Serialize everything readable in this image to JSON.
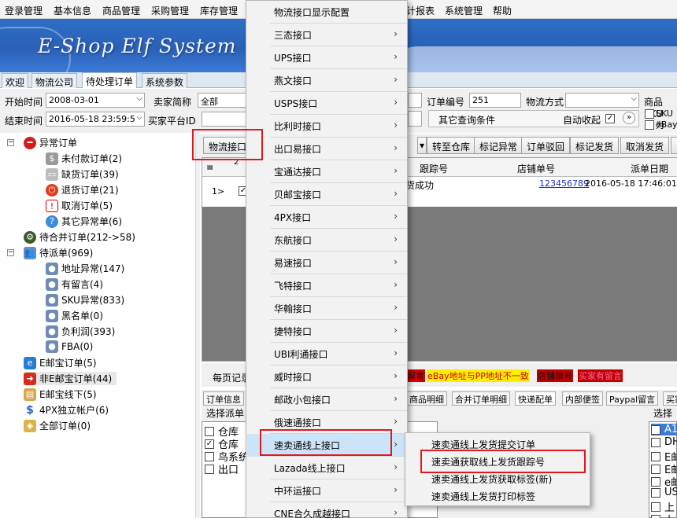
{
  "menubar": [
    "登录管理",
    "基本信息",
    "商品管理",
    "采购管理",
    "库存管理",
    "计报表",
    "系统管理",
    "帮助"
  ],
  "banner": {
    "title": "E-Shop Elf System"
  },
  "main_tabs": [
    "欢迎",
    "物流公司",
    "待处理订单",
    "系统参数"
  ],
  "filters": {
    "start_time_label": "开始时间",
    "start_time": "2008-03-01",
    "end_time_label": "结束时间",
    "end_time": "2016-05-18 23:59:5",
    "buyer_short_label": "卖家简称",
    "buyer_short_value": "全部",
    "buyer_platform_label": "买家平台ID",
    "order_no_label": "订单编号",
    "order_no_value": "251",
    "logistics_label": "物流方式",
    "other_query": "其它查询条件",
    "auto_collapse": "自动收起",
    "sku_label": "商品SKU",
    "sku_cb1": "SKU为",
    "sku_cb2": "eBay"
  },
  "tree": {
    "items": [
      {
        "label": "异常订单",
        "icon": "no-entry-icon"
      },
      {
        "label": "未付款订单(2)",
        "icon": "dollar-icon"
      },
      {
        "label": "缺货订单(39)",
        "icon": "box-icon"
      },
      {
        "label": "退货订单(21)",
        "icon": "power-icon"
      },
      {
        "label": "取消订单(5)",
        "icon": "warning-icon"
      },
      {
        "label": "其它异常单(6)",
        "icon": "question-icon"
      },
      {
        "label": "待合并订单(212->58)",
        "icon": "gear-icon"
      },
      {
        "label": "待派单(969)",
        "icon": "users-icon"
      },
      {
        "label": "地址异常(147)",
        "icon": "user-icon"
      },
      {
        "label": "有留言(4)",
        "icon": "user-icon"
      },
      {
        "label": "SKU异常(833)",
        "icon": "user-icon"
      },
      {
        "label": "黑名单(0)",
        "icon": "user-icon"
      },
      {
        "label": "负利润(393)",
        "icon": "user-icon"
      },
      {
        "label": "FBA(0)",
        "icon": "user-icon"
      },
      {
        "label": "E邮宝订单(5)",
        "icon": "e-icon"
      },
      {
        "label": "非E邮宝订单(44)",
        "icon": "arrow-right-icon"
      },
      {
        "label": "E邮宝线下(5)",
        "icon": "box-icon"
      },
      {
        "label": "4PX独立帐户(6)",
        "icon": "dollar-icon"
      },
      {
        "label": "全部订单(0)",
        "icon": "package-icon"
      }
    ]
  },
  "toolbar": {
    "logistics_button": "物流接口",
    "to_warehouse": "转至仓库",
    "mark_exception": "标记异常",
    "reject_order": "订单驳回",
    "mark_shipped": "标记发货",
    "cancel_ship": "取消发货"
  },
  "grid": {
    "headers": [
      "跟踪号",
      "店铺单号",
      "派单日期"
    ],
    "row": {
      "index": "1>",
      "status": "货成功",
      "shop_no": "123456789",
      "date": "2016-05-18 17:46:01"
    },
    "col2_hdr": "2"
  },
  "legend": {
    "page_size_label": "每页记录",
    "tag_red1": "留言",
    "tag_yellow": "eBay地址与PP地址不一致",
    "tag_red2": "店铺单号",
    "tag_red3": "买家有留言"
  },
  "bottom_tabs": [
    "订单信息",
    "商品明细",
    "合并订单明细",
    "快递配单",
    "内部便签",
    "Paypal留言",
    "买家"
  ],
  "bottom_panel": {
    "left_title": "选择派单",
    "left_items": [
      {
        "label": "仓库",
        "checked": false
      },
      {
        "label": "仓库",
        "checked": true
      },
      {
        "label": "鸟系统",
        "checked": false
      },
      {
        "label": "出口",
        "checked": false
      }
    ],
    "right_title": "选择物",
    "right_items": [
      "A1",
      "DH",
      "E邮",
      "E邮",
      "e邮",
      "US",
      "上",
      "上"
    ]
  },
  "popup_menu": {
    "items": [
      {
        "label": "物流接口显示配置",
        "sub": false
      },
      {
        "label": "三态接口",
        "sub": true
      },
      {
        "label": "UPS接口",
        "sub": true
      },
      {
        "label": "燕文接口",
        "sub": true
      },
      {
        "label": "USPS接口",
        "sub": true
      },
      {
        "label": "比利时接口",
        "sub": true
      },
      {
        "label": "出口易接口",
        "sub": true
      },
      {
        "label": "宝通达接口",
        "sub": true
      },
      {
        "label": "贝邮宝接口",
        "sub": true
      },
      {
        "label": "4PX接口",
        "sub": true
      },
      {
        "label": "东航接口",
        "sub": true
      },
      {
        "label": "易速接口",
        "sub": true
      },
      {
        "label": "飞特接口",
        "sub": true
      },
      {
        "label": "华翰接口",
        "sub": true
      },
      {
        "label": "捷特接口",
        "sub": true
      },
      {
        "label": "UBI利通接口",
        "sub": true
      },
      {
        "label": "威时接口",
        "sub": true
      },
      {
        "label": "邮政小包接口",
        "sub": true
      },
      {
        "label": "俄速通接口",
        "sub": true
      },
      {
        "label": "速卖通线上接口",
        "sub": true
      },
      {
        "label": "Lazada线上接口",
        "sub": true
      },
      {
        "label": "中环运接口",
        "sub": true
      },
      {
        "label": "CNE合久成越接口",
        "sub": true
      }
    ]
  },
  "submenu": {
    "items": [
      "速卖通线上发货提交订单",
      "速卖通获取线上发货跟踪号",
      "速卖通线上发货获取标签(新)",
      "速卖通线上发货打印标签"
    ]
  },
  "colors": {
    "highlight": "#cce4f7",
    "annotation_red": "#e0191e",
    "banner_blue": "#2a60b6"
  }
}
